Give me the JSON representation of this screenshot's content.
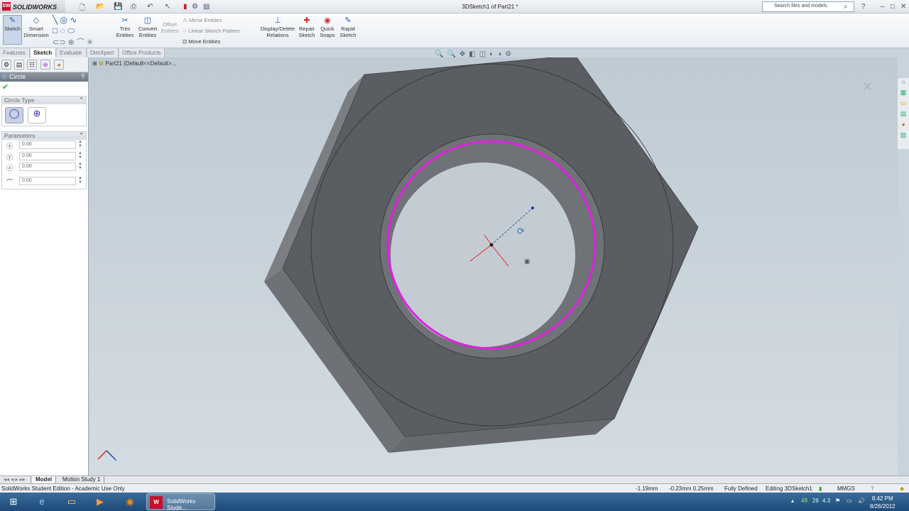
{
  "app": {
    "name": "SOLIDWORKS",
    "doc_title": "3DSketch1 of Part21 *",
    "search_placeholder": "Search files and models"
  },
  "ribbon": {
    "sketch": "Sketch",
    "smart_dimension": "Smart Dimension",
    "trim": "Trim Entities",
    "convert": "Convert Entities",
    "offset": "Offset Entities",
    "mirror": "Mirror Entities",
    "linear_pattern": "Linear Sketch Pattern",
    "move": "Move Entities",
    "display_delete": "Display/Delete Relations",
    "repair": "Repair Sketch",
    "quick_snaps": "Quick Snaps",
    "rapid": "Rapid Sketch"
  },
  "tabs": [
    "Features",
    "Sketch",
    "Evaluate",
    "DimXpert",
    "Office Products"
  ],
  "tree": {
    "root": "Part21  (Default<<Default>..."
  },
  "panel": {
    "title": "Circle",
    "help": "?",
    "circle_type": "Circle Type",
    "parameters": "Parameters",
    "params": [
      {
        "icon": "Cx",
        "value": "0.00"
      },
      {
        "icon": "Cy",
        "value": "0.00"
      },
      {
        "icon": "Cz",
        "value": "0.00"
      },
      {
        "icon": "radius",
        "value": "0.00"
      }
    ]
  },
  "bottom_tabs": [
    "Model",
    "Motion Study 1"
  ],
  "status": {
    "edition": "SolidWorks Student Edition - Academic Use Only",
    "x": "-1.19mm",
    "yz": "-0.23mm  0.25mm",
    "state": "Fully Defined",
    "editing": "Editing 3DSketch1",
    "units": "MMGS"
  },
  "taskbar": {
    "app": "SolidWorks Stude...",
    "tray": [
      "49",
      "26",
      "4.3"
    ],
    "time": "8:42 PM",
    "date": "8/26/2012"
  },
  "colors": {
    "sketch_circle": "#e020e0",
    "model": "#5a5d62",
    "viewport": "#c9d3dc"
  }
}
